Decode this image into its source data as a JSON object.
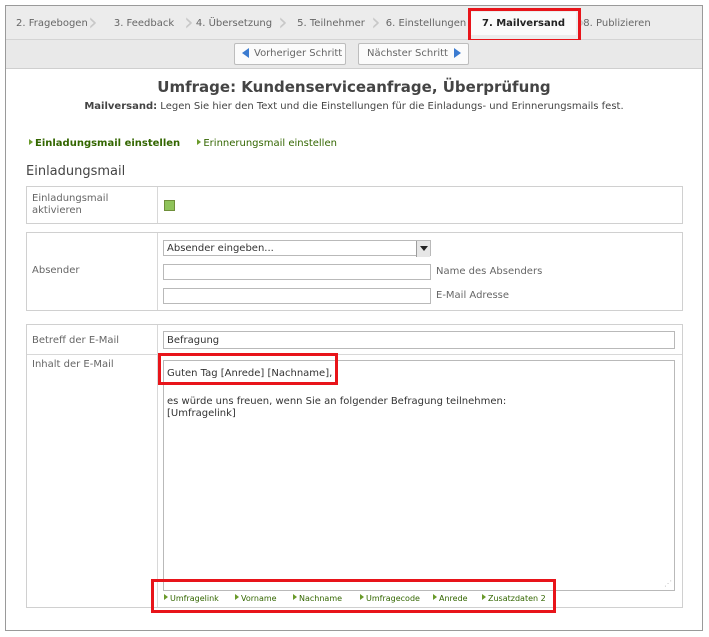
{
  "wizard": {
    "steps": [
      {
        "label": "2. Fragebogen",
        "active": false
      },
      {
        "label": "3. Feedback",
        "active": false
      },
      {
        "label": "4. Übersetzung",
        "active": false
      },
      {
        "label": "5. Teilnehmer",
        "active": false
      },
      {
        "label": "6. Einstellungen",
        "active": false
      },
      {
        "label": "7. Mailversand",
        "active": true
      },
      {
        "label": "8. Publizieren",
        "active": false
      }
    ]
  },
  "nav": {
    "prev_label": "Vorheriger Schritt",
    "next_label": "Nächster Schritt"
  },
  "page": {
    "title": "Umfrage: Kundenserviceanfrage, Überprüfung",
    "subtitle_bold": "Mailversand:",
    "subtitle_text": " Legen Sie hier den Text und die Einstellungen für die Einladungs- und Erinnerungsmails fest."
  },
  "sublinks": {
    "invite": "Einladungsmail einstellen",
    "reminder": "Erinnerungsmail einstellen"
  },
  "section": {
    "title": "Einladungsmail"
  },
  "activate": {
    "label_line1": "Einladungsmail",
    "label_line2": "aktivieren",
    "checked": true
  },
  "sender": {
    "label": "Absender",
    "select_value": "Absender eingeben...",
    "name_label": "Name des Absenders",
    "email_label": "E-Mail Adresse",
    "name_value": "",
    "email_value": ""
  },
  "email": {
    "subject_label": "Betreff der E-Mail",
    "subject_value": "Befragung",
    "body_label": "Inhalt der E-Mail",
    "body_lines": [
      "Guten Tag [Anrede] [Nachname],",
      "",
      "es würde uns freuen, wenn Sie an folgender Befragung teilnehmen:",
      "[Umfragelink]"
    ]
  },
  "placeholders": [
    "Umfragelink",
    "Vorname",
    "Nachname",
    "Umfragecode",
    "Anrede",
    "Zusatzdaten 2"
  ],
  "colors": {
    "highlight": "#e8141a",
    "link_green": "#336600",
    "nav_arrow": "#3b7bd0"
  }
}
